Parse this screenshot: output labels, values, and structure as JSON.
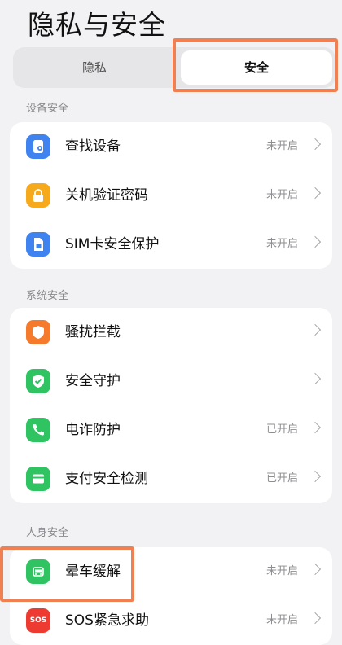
{
  "page": {
    "title": "隐私与安全"
  },
  "tabs": [
    {
      "label": "隐私",
      "selected": false
    },
    {
      "label": "安全",
      "selected": true
    }
  ],
  "sections": [
    {
      "header": "设备安全",
      "items": [
        {
          "label": "查找设备",
          "status": "未开启",
          "icon": "find-device-icon",
          "color": "#3f83f0"
        },
        {
          "label": "关机验证密码",
          "status": "未开启",
          "icon": "lock-icon",
          "color": "#f7a91c"
        },
        {
          "label": "SIM卡安全保护",
          "status": "未开启",
          "icon": "sim-card-icon",
          "color": "#3f83f0"
        }
      ]
    },
    {
      "header": "系统安全",
      "items": [
        {
          "label": "骚扰拦截",
          "status": "",
          "icon": "shield-icon",
          "color": "#f57a2c"
        },
        {
          "label": "安全守护",
          "status": "",
          "icon": "shield-check-icon",
          "color": "#2fc461"
        },
        {
          "label": "电诈防护",
          "status": "已开启",
          "icon": "phone-icon",
          "color": "#2fc461"
        },
        {
          "label": "支付安全检测",
          "status": "已开启",
          "icon": "wallet-icon",
          "color": "#2fc461"
        }
      ]
    },
    {
      "header": "人身安全",
      "items": [
        {
          "label": "晕车缓解",
          "status": "未开启",
          "icon": "car-icon",
          "color": "#2fc461"
        },
        {
          "label": "SOS紧急求助",
          "status": "未开启",
          "icon": "sos-icon",
          "color": "#ee3b32"
        }
      ]
    }
  ]
}
